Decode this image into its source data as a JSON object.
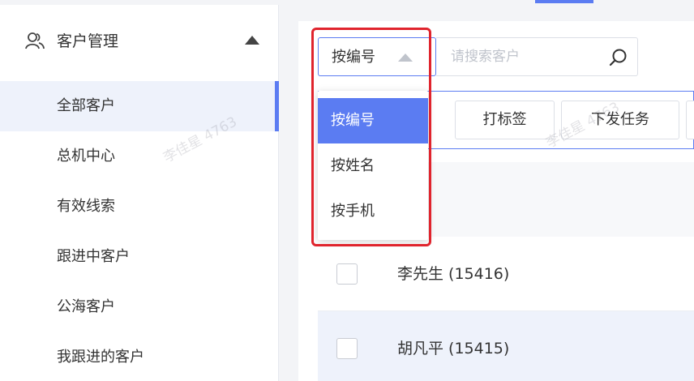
{
  "sidebar": {
    "group": {
      "label": "客户管理",
      "icon": "users-icon",
      "expanded": true
    },
    "items": [
      {
        "label": "全部客户",
        "active": true
      },
      {
        "label": "总机中心",
        "active": false
      },
      {
        "label": "有效线索",
        "active": false
      },
      {
        "label": "跟进中客户",
        "active": false
      },
      {
        "label": "公海客户",
        "active": false
      },
      {
        "label": "我跟进的客户",
        "active": false
      }
    ]
  },
  "search": {
    "selected_field": "按编号",
    "placeholder": "请搜索客户",
    "value": ""
  },
  "dropdown": {
    "options": [
      {
        "label": "按编号",
        "selected": true
      },
      {
        "label": "按姓名",
        "selected": false
      },
      {
        "label": "按手机",
        "selected": false
      }
    ]
  },
  "toolbar": {
    "tag_label": "打标签",
    "task_label": "下发任务"
  },
  "table": {
    "rows": [
      {
        "name": "李先生 (15416)",
        "checked": false
      },
      {
        "name": "胡凡平 (15415)",
        "checked": false
      }
    ]
  },
  "watermark": "李佳星 4763",
  "colors": {
    "accent": "#5b7cf2",
    "highlight": "#e0242d",
    "active_row": "#eef2fb"
  }
}
